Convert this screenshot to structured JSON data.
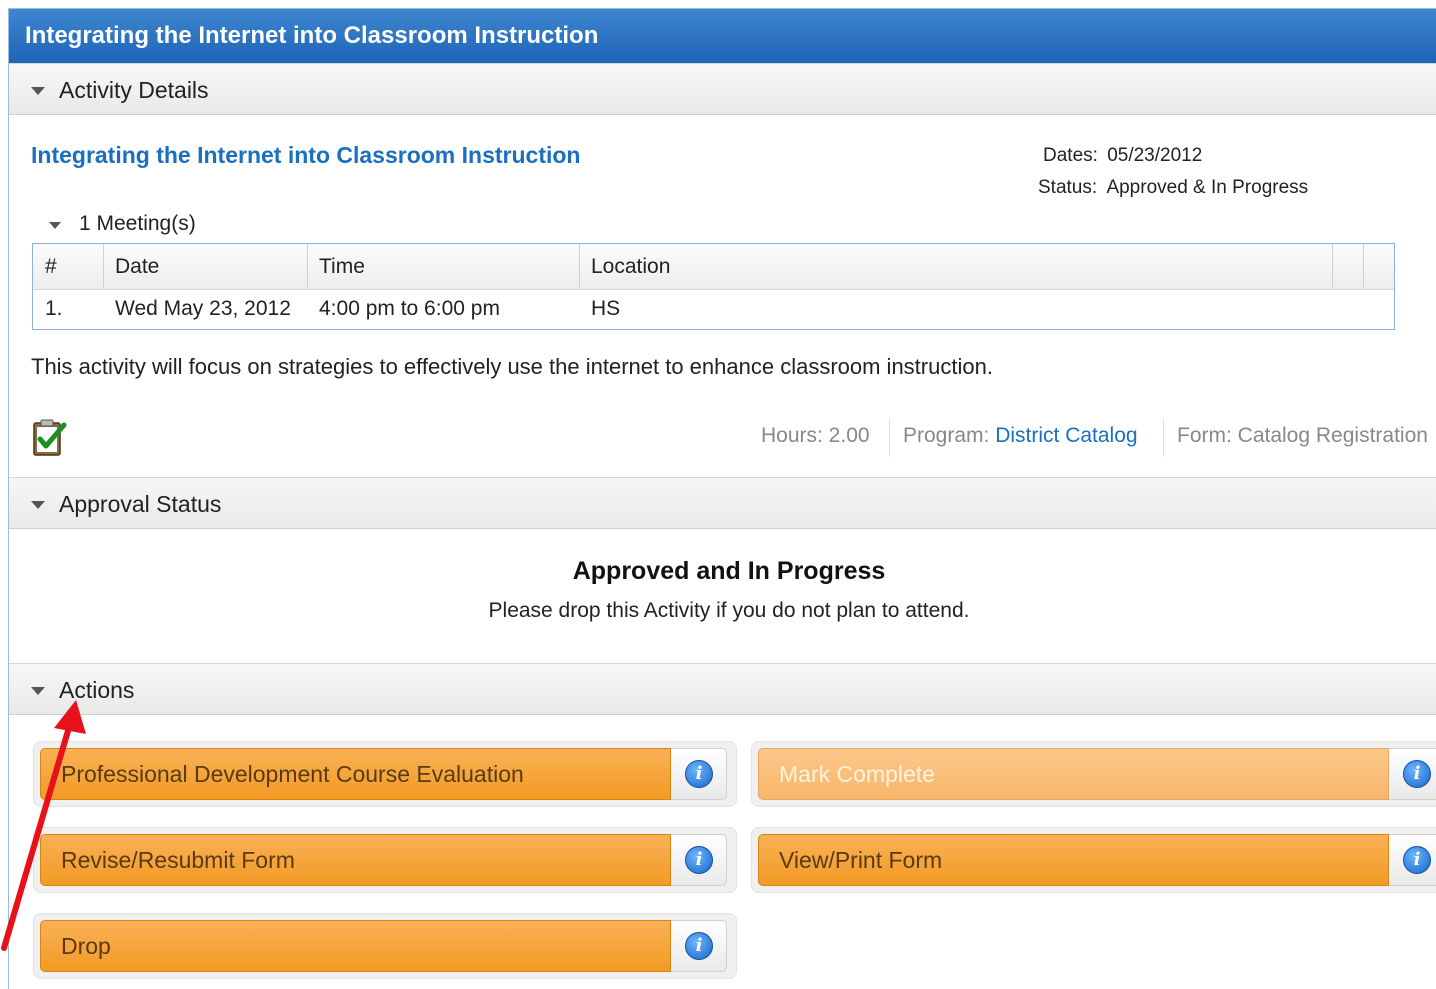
{
  "window": {
    "title": "Integrating the Internet into Classroom Instruction"
  },
  "sections": {
    "activity_details": "Activity Details",
    "approval_status": "Approval Status",
    "actions": "Actions"
  },
  "activity": {
    "name": "Integrating the Internet into Classroom Instruction",
    "dates_label": "Dates:",
    "dates_value": "05/23/2012",
    "status_label": "Status:",
    "status_value": "Approved & In Progress",
    "meetings_toggle": "1 Meeting(s)",
    "description": "This activity will focus on strategies to effectively use the internet to enhance classroom instruction.",
    "hours": "Hours: 2.00",
    "program_label": "Program:",
    "program_value": "District Catalog",
    "form": "Form: Catalog Registration"
  },
  "meetings_table": {
    "columns": [
      "#",
      "Date",
      "Time",
      "Location"
    ],
    "rows": [
      [
        "1.",
        "Wed May 23, 2012",
        "4:00 pm to 6:00 pm",
        "HS"
      ]
    ]
  },
  "approval": {
    "title": "Approved and In Progress",
    "message": "Please drop this Activity if you do not plan to attend."
  },
  "actions": [
    {
      "label": "Professional Development Course Evaluation",
      "icon": "info-icon",
      "enabled": true
    },
    {
      "label": "Mark Complete",
      "icon": "info-icon",
      "enabled": false
    },
    {
      "label": "Revise/Resubmit Form",
      "icon": "info-icon",
      "enabled": true
    },
    {
      "label": "View/Print Form",
      "icon": "info-icon",
      "enabled": true
    },
    {
      "label": "Drop",
      "icon": "info-icon",
      "enabled": true
    }
  ],
  "info_glyph": "i",
  "icons": {
    "form_status": "clipboard-check-icon",
    "annotation": "red-arrow-icon"
  },
  "colors": {
    "titlebar": "#1e64b5",
    "link": "#1a6fc0",
    "action_button": "#f29a25",
    "action_button_disabled": "#f8b66a",
    "annotation_arrow": "#e8101a"
  }
}
